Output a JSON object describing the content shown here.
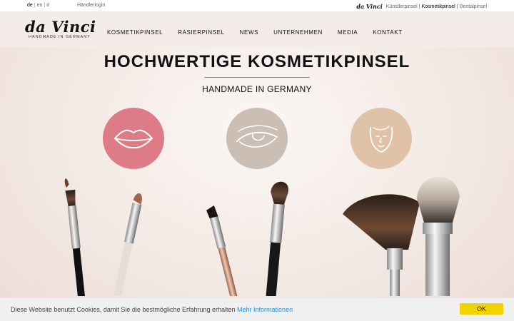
{
  "topbar": {
    "languages": [
      "de",
      "en",
      "it"
    ],
    "separator": "|",
    "dealer_login": "Händlerlogin",
    "brand_mini": "da Vinci",
    "brand_links": [
      "Künstlerpinsel",
      "Kosmetikpinsel",
      "Dentalpinsel"
    ]
  },
  "header": {
    "logo_script": "da Vinci",
    "logo_tagline": "HANDMADE IN GERMANY",
    "nav": [
      "KOSMETIKPINSEL",
      "RASIERPINSEL",
      "NEWS",
      "UNTERNEHMEN",
      "MEDIA",
      "KONTAKT"
    ]
  },
  "hero": {
    "title": "HOCHWERTIGE KOSMETIKPINSEL",
    "subtitle": "HANDMADE IN GERMANY",
    "categories": [
      {
        "icon": "lips-icon",
        "color": "#dd7b86"
      },
      {
        "icon": "eye-icon",
        "color": "#cbbeb4"
      },
      {
        "icon": "face-icon",
        "color": "#e0c2a8"
      }
    ]
  },
  "cookie": {
    "text": "Diese Website benutzt Cookies, damit Sie die bestmögliche Erfahrung erhalten",
    "link": "Mehr Informationen",
    "ok": "OK"
  }
}
